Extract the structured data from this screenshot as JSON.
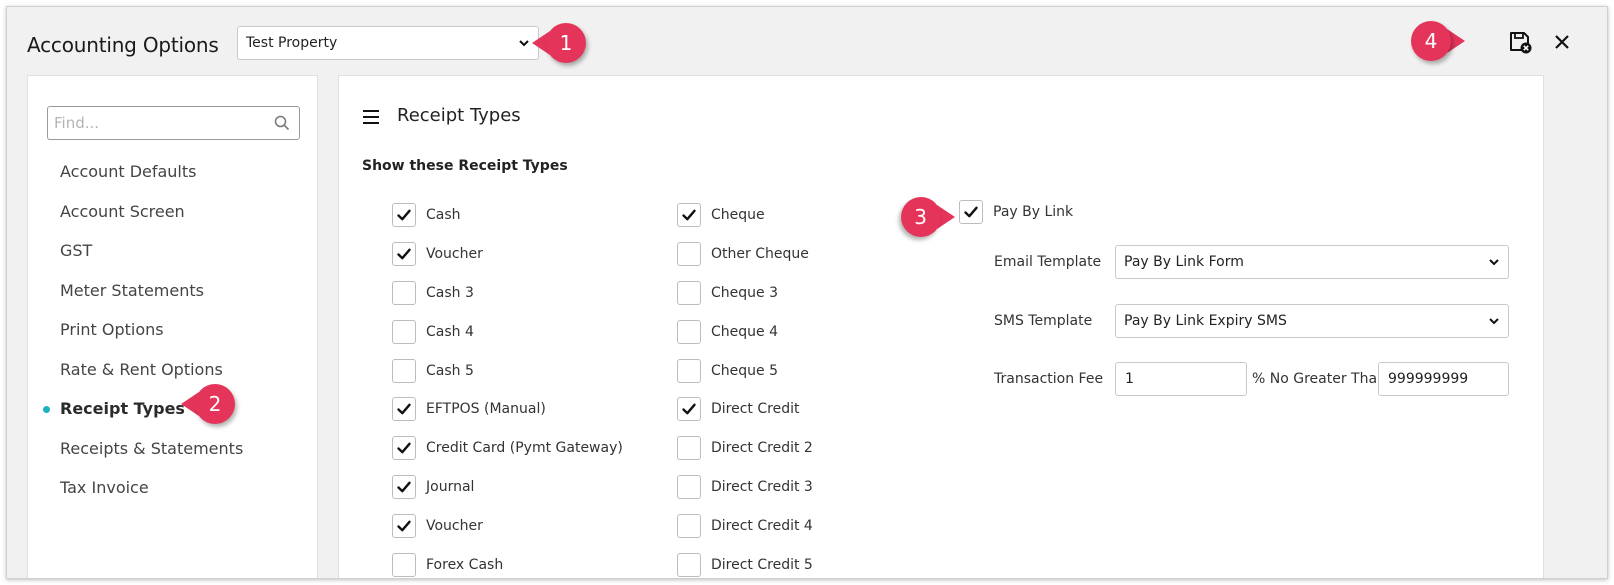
{
  "window": {
    "title": "Accounting Options",
    "property_select": {
      "value": "Test Property"
    }
  },
  "callouts": [
    "1",
    "2",
    "3",
    "4"
  ],
  "toolbar": {
    "save_close_icon": "save-close-icon",
    "close_icon": "close-icon"
  },
  "sidebar": {
    "search_placeholder": "Find...",
    "items": [
      {
        "label": "Account Defaults",
        "active": false
      },
      {
        "label": "Account Screen",
        "active": false
      },
      {
        "label": "GST",
        "active": false
      },
      {
        "label": "Meter Statements",
        "active": false
      },
      {
        "label": "Print Options",
        "active": false
      },
      {
        "label": "Rate & Rent Options",
        "active": false
      },
      {
        "label": "Receipt Types",
        "active": true
      },
      {
        "label": "Receipts & Statements",
        "active": false
      },
      {
        "label": "Tax Invoice",
        "active": false
      }
    ]
  },
  "main": {
    "title": "Receipt Types",
    "show_label": "Show these Receipt Types",
    "column1": [
      {
        "label": "Cash",
        "checked": true
      },
      {
        "label": "Voucher",
        "checked": true
      },
      {
        "label": "Cash 3",
        "checked": false
      },
      {
        "label": "Cash 4",
        "checked": false
      },
      {
        "label": "Cash 5",
        "checked": false
      },
      {
        "label": "EFTPOS (Manual)",
        "checked": true
      },
      {
        "label": "Credit Card (Pymt Gateway)",
        "checked": true
      },
      {
        "label": "Journal",
        "checked": true
      },
      {
        "label": "Voucher",
        "checked": true
      },
      {
        "label": "Forex Cash",
        "checked": false
      }
    ],
    "column2": [
      {
        "label": "Cheque",
        "checked": true
      },
      {
        "label": "Other Cheque",
        "checked": false
      },
      {
        "label": "Cheque 3",
        "checked": false
      },
      {
        "label": "Cheque 4",
        "checked": false
      },
      {
        "label": "Cheque 5",
        "checked": false
      },
      {
        "label": "Direct Credit",
        "checked": true
      },
      {
        "label": "Direct Credit 2",
        "checked": false
      },
      {
        "label": "Direct Credit 3",
        "checked": false
      },
      {
        "label": "Direct Credit 4",
        "checked": false
      },
      {
        "label": "Direct Credit 5",
        "checked": false
      }
    ],
    "pay_by_link": {
      "label": "Pay By Link",
      "checked": true,
      "email_template_label": "Email Template",
      "email_template_value": "Pay By Link Form",
      "sms_template_label": "SMS Template",
      "sms_template_value": "Pay By Link Expiry SMS",
      "transaction_fee_label": "Transaction Fee",
      "transaction_fee_value": "1",
      "no_greater_than_label": "% No Greater Than",
      "no_greater_than_value": "999999999"
    }
  },
  "colors": {
    "accent_dot": "#1bb3c4",
    "callout": "#e5345a"
  }
}
